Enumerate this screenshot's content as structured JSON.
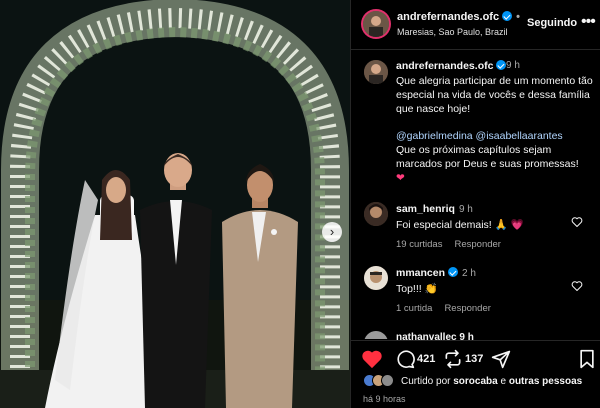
{
  "header": {
    "username": "andrefernandes.ofc",
    "location": "Maresias, Sao Paulo, Brazil",
    "follow_label": "Seguindo",
    "more_icon": "more-horizontal-icon"
  },
  "caption": {
    "username": "andrefernandes.ofc",
    "time": "9 h",
    "text_line1": "Que alegria participar de um momento tão especial na vida de vocês e dessa família que nasce hoje!",
    "mentions": "@gabrielmedina @isaabellaarantes",
    "text_line2": "Que os próximas capítulos sejam marcados por Deus e suas promessas!",
    "emoji": "❤"
  },
  "comments": [
    {
      "username": "sam_henriq",
      "time": "9 h",
      "text": "Foi especial demais!",
      "emojis": "🙏 💗",
      "likes": "19 curtidas",
      "reply": "Responder"
    },
    {
      "username": "mmancen",
      "time": "2 h",
      "text": "Top!!!",
      "emojis": "👏",
      "likes": "1 curtida",
      "reply": "Responder"
    }
  ],
  "partial_comment": {
    "username": "nathanvallec 9 h"
  },
  "actions": {
    "comment_count": "421",
    "repost_count": "137",
    "liked_by_prefix": "Curtido por",
    "liked_by_user": "sorocaba",
    "liked_by_conj": "e",
    "liked_by_others": "outras pessoas",
    "post_time": "há 9 horas"
  },
  "colors": {
    "like_red": "#ff3040",
    "verified_blue": "#0095f6",
    "mention_blue": "#b2d6ff"
  }
}
